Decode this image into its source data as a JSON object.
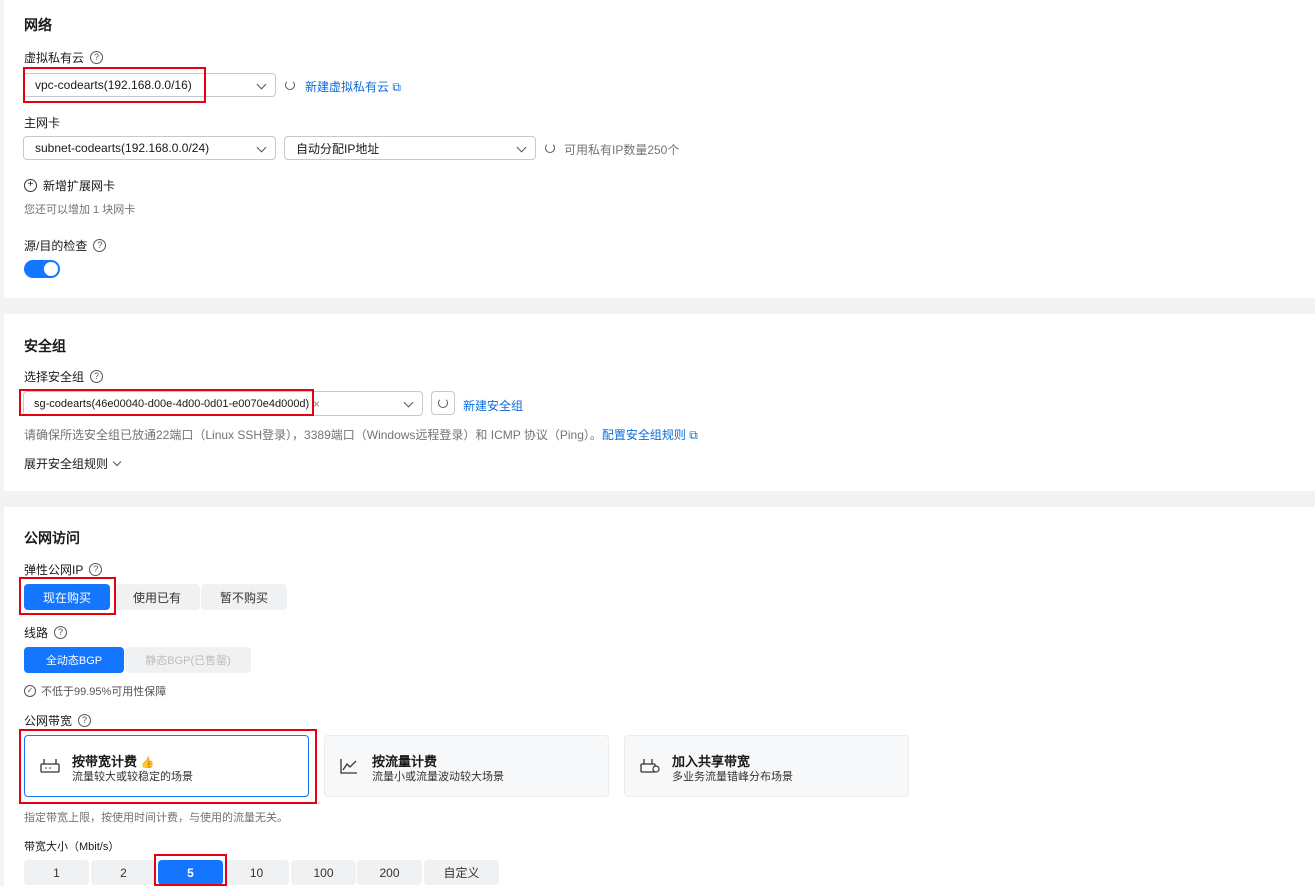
{
  "network": {
    "title": "网络",
    "vpc_label": "虚拟私有云",
    "vpc_value": "vpc-codearts(192.168.0.0/16)",
    "new_vpc_link": "新建虚拟私有云",
    "nic_label": "主网卡",
    "subnet_value": "subnet-codearts(192.168.0.0/24)",
    "ip_mode_value": "自动分配IP地址",
    "ip_available": "可用私有IP数量250个",
    "add_nic": "新增扩展网卡",
    "add_nic_hint": "您还可以增加 1 块网卡",
    "src_dst_check_label": "源/目的检查",
    "src_dst_check_on": true
  },
  "security": {
    "title": "安全组",
    "select_label": "选择安全组",
    "selected_group": "sg-codearts(46e00040-d00e-4d00-0d01-e0070e4d000d)",
    "new_group_link": "新建安全组",
    "hint": "请确保所选安全组已放通22端口（Linux SSH登录），3389端口（Windows远程登录）和 ICMP 协议（Ping）。",
    "config_rules_link": "配置安全组规则",
    "expand_rules": "展开安全组规则"
  },
  "public": {
    "title": "公网访问",
    "eip_label": "弹性公网IP",
    "eip_options": [
      "现在购买",
      "使用已有",
      "暂不购买"
    ],
    "eip_selected": "现在购买",
    "line_label": "线路",
    "line_options": [
      "全动态BGP",
      "静态BGP(已售罄)"
    ],
    "line_note": "不低于99.95%可用性保障",
    "bandwidth_label": "公网带宽",
    "bandwidth_cards": [
      {
        "title": "按带宽计费",
        "subtitle": "流量较大或较稳定的场景",
        "icon": "router-icon"
      },
      {
        "title": "按流量计费",
        "subtitle": "流量小或流量波动较大场景",
        "icon": "line-chart-icon"
      },
      {
        "title": "加入共享带宽",
        "subtitle": "多业务流量错峰分布场景",
        "icon": "shared-router-icon"
      }
    ],
    "bandwidth_note": "指定带宽上限，按使用时间计费，与使用的流量无关。",
    "size_label": "带宽大小（Mbit/s）",
    "size_options": [
      "1",
      "2",
      "5",
      "10",
      "100",
      "200",
      "自定义"
    ],
    "size_selected": "5"
  },
  "colors": {
    "accent": "#1476ff",
    "link": "#0d6ddb",
    "highlight": "#e60012"
  }
}
